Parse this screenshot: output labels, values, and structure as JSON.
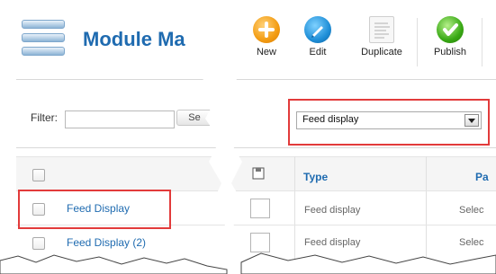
{
  "title": "Module Ma",
  "filter": {
    "label": "Filter:",
    "value": "",
    "button_label": "Se"
  },
  "rows": [
    {
      "name": "Feed Display"
    },
    {
      "name": "Feed Display (2)"
    }
  ],
  "toolbar": {
    "new_label": "New",
    "edit_label": "Edit",
    "duplicate_label": "Duplicate",
    "publish_label": "Publish"
  },
  "type_filter": {
    "selected": "Feed display"
  },
  "table": {
    "type_header": "Type",
    "position_header": "Pa",
    "rows": [
      {
        "type": "Feed display",
        "position": "Selec"
      },
      {
        "type": "Feed display",
        "position": "Selec"
      }
    ]
  },
  "colors": {
    "link": "#1f6bb0",
    "highlight": "#e23b3b"
  }
}
